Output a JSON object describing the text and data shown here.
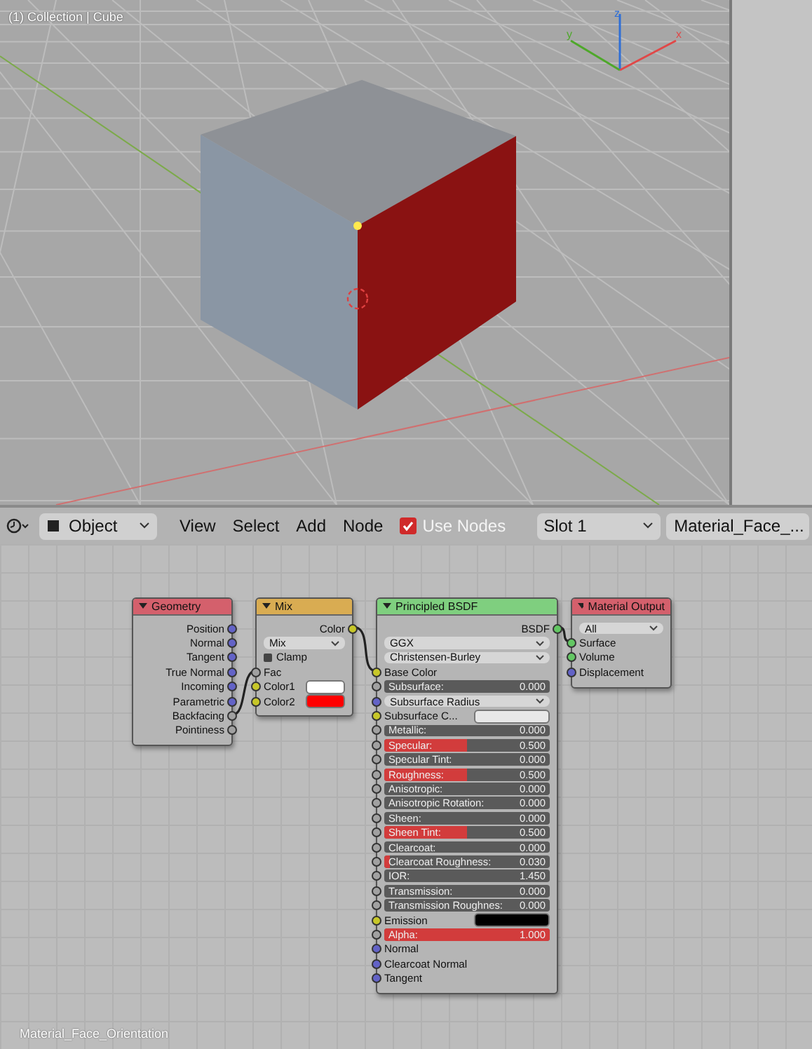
{
  "viewport": {
    "info": "(1) Collection | Cube",
    "axes": [
      {
        "label": "z",
        "kind": "z"
      },
      {
        "label": "y",
        "kind": "y"
      },
      {
        "label": "x",
        "kind": "x"
      }
    ]
  },
  "header": {
    "mode": "Object",
    "menus": [
      "View",
      "Select",
      "Add",
      "Node"
    ],
    "use_nodes": {
      "label": "Use Nodes",
      "checked": true
    },
    "slot": "Slot 1",
    "material": "Material_Face_..."
  },
  "nodes": [
    {
      "title": "Geometry",
      "color": "#d4606c",
      "rows": [
        {
          "kind": "output",
          "label": "Position",
          "socket": {
            "color": "#6363c7"
          }
        },
        {
          "kind": "output",
          "label": "Normal",
          "socket": {
            "color": "#6363c7"
          }
        },
        {
          "kind": "output",
          "label": "Tangent",
          "socket": {
            "color": "#6363c7"
          }
        },
        {
          "kind": "output",
          "label": "True Normal",
          "socket": {
            "color": "#6363c7"
          }
        },
        {
          "kind": "output",
          "label": "Incoming",
          "socket": {
            "color": "#6363c7"
          }
        },
        {
          "kind": "output",
          "label": "Parametric",
          "socket": {
            "color": "#6363c7"
          }
        },
        {
          "kind": "output",
          "label": "Backfacing",
          "socket": {
            "color": "#a1a1a1"
          }
        },
        {
          "kind": "output",
          "label": "Pointiness",
          "socket": {
            "color": "#a1a1a1"
          }
        }
      ]
    },
    {
      "title": "Mix",
      "color": "#d9ac52",
      "rows": [
        {
          "kind": "output",
          "label": "Color",
          "socket": {
            "color": "#c7c729"
          }
        },
        {
          "kind": "dropdown",
          "label": "Mix"
        },
        {
          "kind": "checkbox",
          "label": "Clamp",
          "checked": false
        },
        {
          "kind": "input",
          "label": "Fac",
          "socket": {
            "color": "#a1a1a1"
          }
        },
        {
          "kind": "swatch",
          "label": "Color1",
          "socket": {
            "color": "#c7c729"
          },
          "color": "#ffffff"
        },
        {
          "kind": "swatch",
          "label": "Color2",
          "socket": {
            "color": "#c7c729"
          },
          "color": "#ff0000"
        }
      ]
    },
    {
      "title": "Principled BSDF",
      "color": "#7fcf7f",
      "rows": [
        {
          "kind": "output",
          "label": "BSDF",
          "socket": {
            "color": "#63c763"
          }
        },
        {
          "kind": "dropdown",
          "label": "GGX"
        },
        {
          "kind": "dropdown",
          "label": "Christensen-Burley"
        },
        {
          "kind": "input",
          "label": "Base Color",
          "socket": {
            "color": "#c7c729"
          }
        },
        {
          "kind": "slider",
          "label": "Subsurface:",
          "value": "0.000",
          "level": 0,
          "socket": {
            "color": "#a1a1a1"
          }
        },
        {
          "kind": "dropdown",
          "label": "Subsurface Radius",
          "socket": {
            "color": "#6363c7"
          }
        },
        {
          "kind": "swatch",
          "label": "Subsurface C...",
          "socket": {
            "color": "#c7c729"
          },
          "color": "#e8e8e8"
        },
        {
          "kind": "slider",
          "label": "Metallic:",
          "value": "0.000",
          "level": 0,
          "socket": {
            "color": "#a1a1a1"
          }
        },
        {
          "kind": "slider",
          "label": "Specular:",
          "value": "0.500",
          "level": 0.5,
          "socket": {
            "color": "#a1a1a1"
          }
        },
        {
          "kind": "slider",
          "label": "Specular Tint:",
          "value": "0.000",
          "level": 0,
          "socket": {
            "color": "#a1a1a1"
          }
        },
        {
          "kind": "slider",
          "label": "Roughness:",
          "value": "0.500",
          "level": 0.5,
          "socket": {
            "color": "#a1a1a1"
          }
        },
        {
          "kind": "slider",
          "label": "Anisotropic:",
          "value": "0.000",
          "level": 0,
          "socket": {
            "color": "#a1a1a1"
          }
        },
        {
          "kind": "slider",
          "label": "Anisotropic Rotation:",
          "value": "0.000",
          "level": 0,
          "socket": {
            "color": "#a1a1a1"
          }
        },
        {
          "kind": "slider",
          "label": "Sheen:",
          "value": "0.000",
          "level": 0,
          "socket": {
            "color": "#a1a1a1"
          }
        },
        {
          "kind": "slider",
          "label": "Sheen Tint:",
          "value": "0.500",
          "level": 0.5,
          "socket": {
            "color": "#a1a1a1"
          }
        },
        {
          "kind": "slider",
          "label": "Clearcoat:",
          "value": "0.000",
          "level": 0,
          "socket": {
            "color": "#a1a1a1"
          }
        },
        {
          "kind": "slider",
          "label": "Clearcoat Roughness:",
          "value": "0.030",
          "level": 0.03,
          "socket": {
            "color": "#a1a1a1"
          }
        },
        {
          "kind": "slider",
          "label": "IOR:",
          "value": "1.450",
          "level": 0,
          "socket": {
            "color": "#a1a1a1"
          }
        },
        {
          "kind": "slider",
          "label": "Transmission:",
          "value": "0.000",
          "level": 0,
          "socket": {
            "color": "#a1a1a1"
          }
        },
        {
          "kind": "slider",
          "label": "Transmission Roughnes:",
          "value": "0.000",
          "level": 0,
          "socket": {
            "color": "#a1a1a1"
          }
        },
        {
          "kind": "swatch",
          "label": "Emission",
          "socket": {
            "color": "#c7c729"
          },
          "color": "#000000"
        },
        {
          "kind": "slider",
          "label": "Alpha:",
          "value": "1.000",
          "level": 1,
          "socket": {
            "color": "#a1a1a1"
          }
        },
        {
          "kind": "input",
          "label": "Normal",
          "socket": {
            "color": "#6363c7"
          }
        },
        {
          "kind": "input",
          "label": "Clearcoat Normal",
          "socket": {
            "color": "#6363c7"
          }
        },
        {
          "kind": "input",
          "label": "Tangent",
          "socket": {
            "color": "#6363c7"
          }
        }
      ]
    },
    {
      "title": "Material Output",
      "color": "#d4606c",
      "rows": [
        {
          "kind": "dropdown",
          "label": "All"
        },
        {
          "kind": "input",
          "label": "Surface",
          "socket": {
            "color": "#63c763"
          }
        },
        {
          "kind": "input",
          "label": "Volume",
          "socket": {
            "color": "#63c763"
          }
        },
        {
          "kind": "input",
          "label": "Displacement",
          "socket": {
            "color": "#6363c7"
          }
        }
      ]
    }
  ],
  "footer": "Material_Face_Orientation"
}
